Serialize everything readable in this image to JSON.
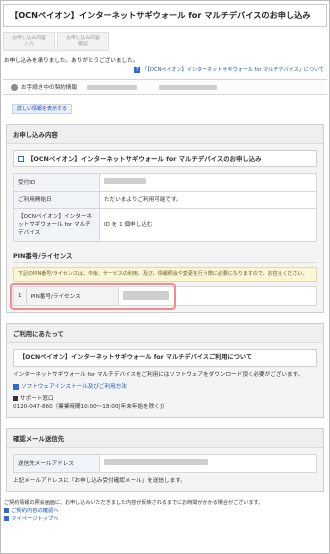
{
  "header": {
    "title": "【OCNペイオン】インターネットサギウォール for マルチデバイスのお申し込み"
  },
  "steps": [
    {
      "line1": "お申し込み内容",
      "line2": "入力"
    },
    {
      "line1": "お申し込み内容",
      "line2": "確認"
    }
  ],
  "message": "お申し込みを承りました。ありがとうございました。",
  "notice_link": "「【OCNペイオン】インターネットサギウォール for マルチデバイス」について",
  "contract": {
    "label": "お手続き中の契約情報"
  },
  "detail_button": "詳しい情報を表示する",
  "application": {
    "heading": "お申し込み内容",
    "product_title": "【OCNペイオン】インターネットサギウォール for マルチデバイスのお申し込み",
    "rows": [
      {
        "key": "受付ID",
        "value": ""
      },
      {
        "key": "ご利用開始日",
        "value": "ただいまよりご利用可能です。"
      },
      {
        "key": "【OCNペイオン】インターネットサギウォール for マルチデバイス",
        "value": "ID を 1 個申し込む"
      }
    ],
    "pin_heading": "PIN番号/ライセンス",
    "pin_warning": "下記のPIN番号/ライセンスは、今後、サービスの利用、及び、情報照会や変更を行う際に必要になりますので、お控えください。",
    "pin_row": {
      "index": "1",
      "label": "PIN番号/ライセンス"
    }
  },
  "usage": {
    "heading": "ご利用にあたって",
    "title": "【OCNペイオン】インターネットサギウォール for マルチデバイスご利用について",
    "body": "インターネットサギウォール for マルチデバイスをご利用にはソフトウェアをダウンロード頂く必要がございます。",
    "install_link": "ソフトウェアインストール及びご利用方法",
    "support_heading": "サポート窓口",
    "support_line": "0120-047-860（業業時間10:00～18:00[年末年始を除く]）"
  },
  "email": {
    "heading": "確認メール送信先",
    "label": "送信先メールアドレス",
    "note": "上記メールアドレスに「お申し込み受付確認メール」を送信します。"
  },
  "footer": {
    "text": "ご契約情報の照会画面に、お申し込みいただきました内容が反映されるまでにお時間がかかる場合がございます。",
    "links": [
      "ご契約内容の確認へ",
      "マイページトップへ"
    ]
  }
}
